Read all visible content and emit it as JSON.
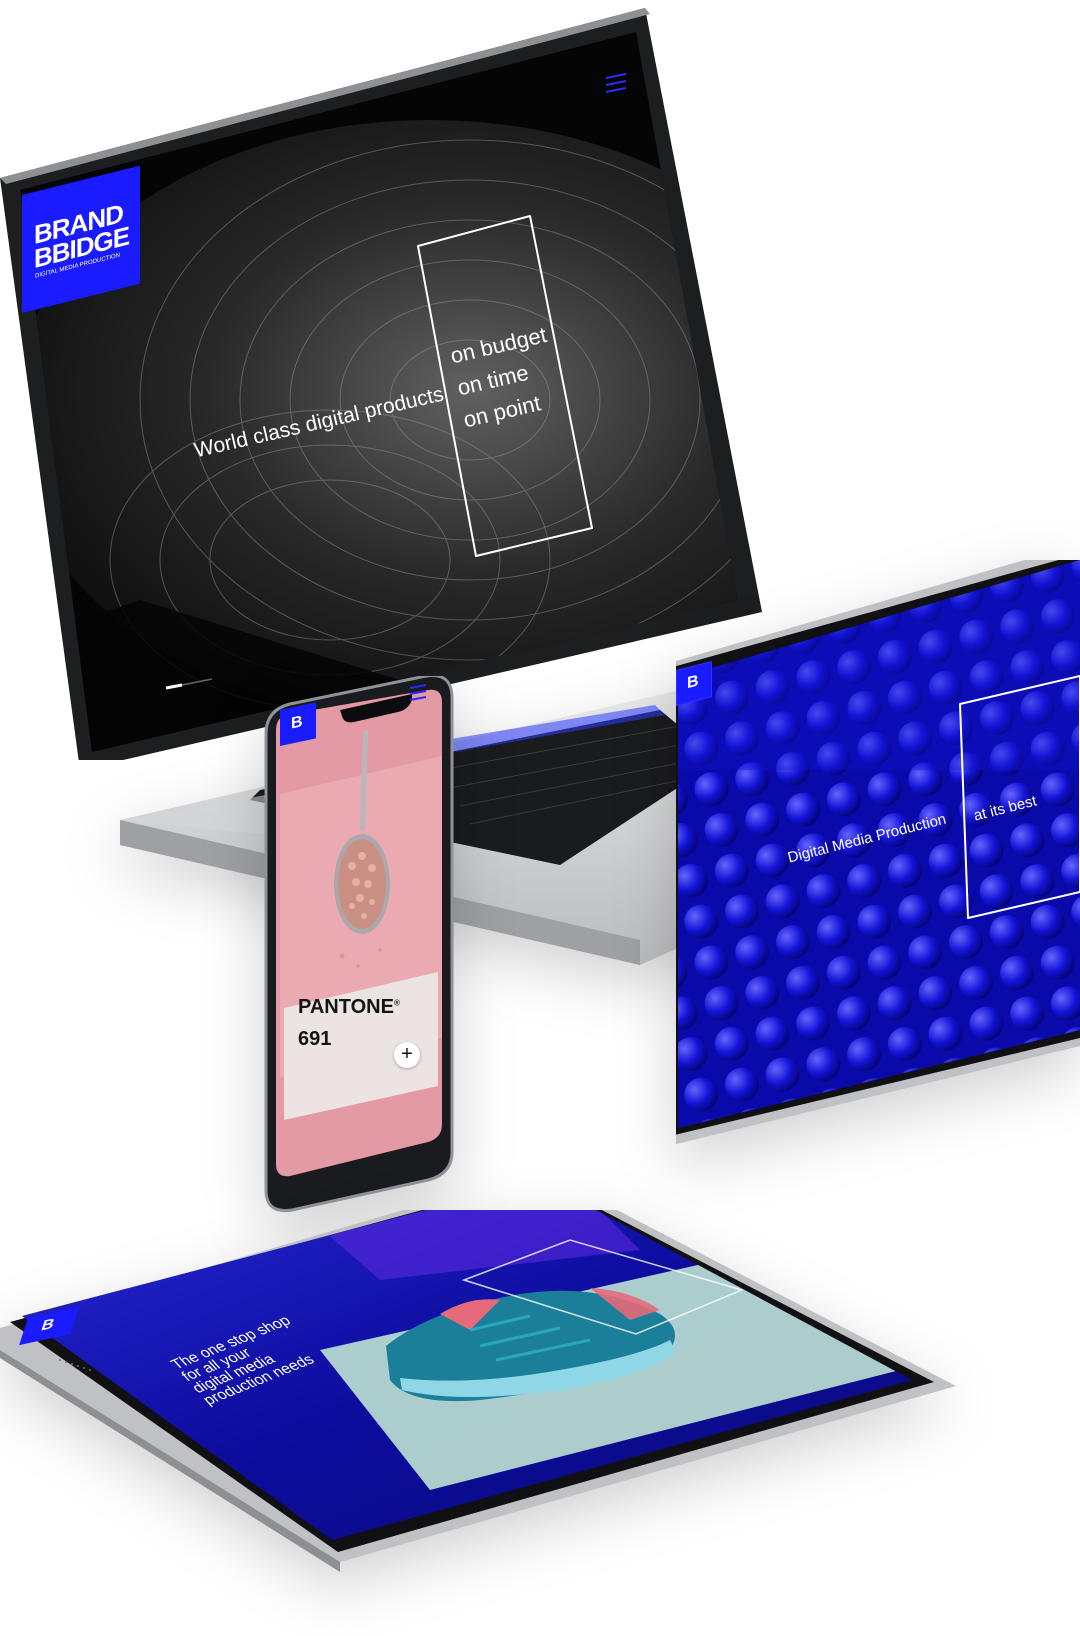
{
  "colors": {
    "brand_blue": "#1b1bff",
    "pink": "#e39aa4",
    "dark_screen": "#050505",
    "device_silver": "#c9cbce",
    "device_dark": "#2a2b2e"
  },
  "laptop": {
    "logo_line1": "BRAND",
    "logo_line2": "BBIDGE",
    "logo_tagline": "DIGITAL MEDIA PRODUCTION",
    "headline": "World class digital products",
    "tagline_1": "on budget",
    "tagline_2": "on time",
    "tagline_3": "on point",
    "menu_icon": "hamburger-icon"
  },
  "phone": {
    "logo": "B",
    "menu_icon": "hamburger-icon",
    "card_brand": "PANTONE",
    "card_mark": "®",
    "card_number": "691",
    "add_icon": "plus-icon",
    "add_label": "+"
  },
  "ipad_right": {
    "logo": "B",
    "headline": "Digital Media Production",
    "tagline": "at its best"
  },
  "ipad_bottom": {
    "logo": "B",
    "line1": "The one stop shop",
    "line2": "for all your",
    "line3": "digital media",
    "line4": "production needs"
  }
}
